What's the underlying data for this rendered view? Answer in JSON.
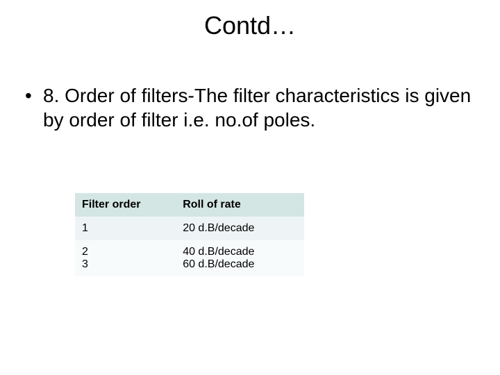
{
  "title": "Contd…",
  "bullet": {
    "marker": "•",
    "text": "8. Order of filters-The filter characteristics is given by order of filter i.e. no.of poles."
  },
  "table": {
    "header": {
      "col_a": "Filter order",
      "col_b": "Roll of rate"
    },
    "rows": [
      {
        "col_a": "1",
        "col_b": "20 d.B/decade"
      },
      {
        "col_a": "2\n3",
        "col_b": "40 d.B/decade\n60 d.B/decade"
      }
    ]
  }
}
